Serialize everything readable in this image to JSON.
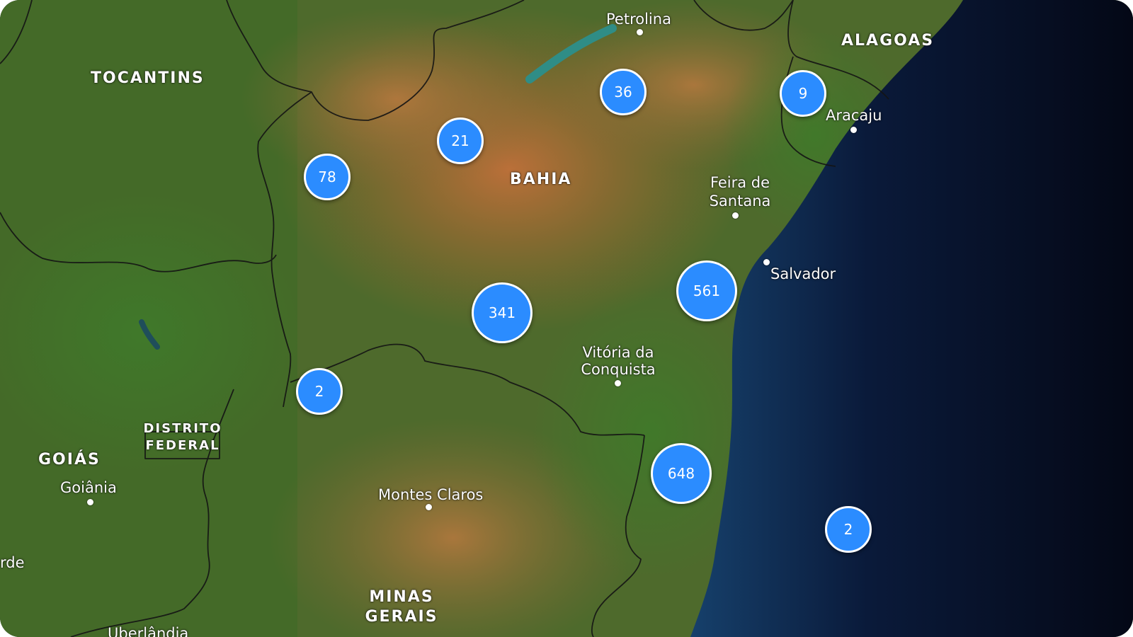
{
  "map": {
    "colors": {
      "cluster_fill": "#2b8cff",
      "cluster_border": "#ffffff",
      "ocean": "#050a1a",
      "land_dark": "#2f5a22",
      "land_arid": "#b86a32"
    },
    "states": [
      {
        "id": "tocantins",
        "name": "TOCANTINS"
      },
      {
        "id": "bahia",
        "name": "BAHIA"
      },
      {
        "id": "alagoas",
        "name": "ALAGOAS"
      },
      {
        "id": "distrito-federal",
        "name": "DISTRITO FEDERAL"
      },
      {
        "id": "goias",
        "name": "GOIÁS"
      },
      {
        "id": "minas-gerais",
        "name": "MINAS GERAIS"
      }
    ],
    "cities": [
      {
        "id": "petrolina",
        "name": "Petrolina"
      },
      {
        "id": "aracaju",
        "name": "Aracaju"
      },
      {
        "id": "feira-de-santana",
        "name": "Feira de Santana"
      },
      {
        "id": "salvador",
        "name": "Salvador"
      },
      {
        "id": "vitoria-da-conquista",
        "name": "Vitória da Conquista"
      },
      {
        "id": "montes-claros",
        "name": "Montes Claros"
      },
      {
        "id": "goiania",
        "name": "Goiânia"
      },
      {
        "id": "uberlandia",
        "name": "Uberlândia"
      },
      {
        "id": "edge-fragment",
        "name": "rde"
      }
    ],
    "clusters": [
      {
        "id": "c36",
        "count": "36"
      },
      {
        "id": "c9",
        "count": "9"
      },
      {
        "id": "c21",
        "count": "21"
      },
      {
        "id": "c78",
        "count": "78"
      },
      {
        "id": "c341",
        "count": "341"
      },
      {
        "id": "c561",
        "count": "561"
      },
      {
        "id": "c2a",
        "count": "2"
      },
      {
        "id": "c648",
        "count": "648"
      },
      {
        "id": "c2b",
        "count": "2"
      }
    ]
  }
}
